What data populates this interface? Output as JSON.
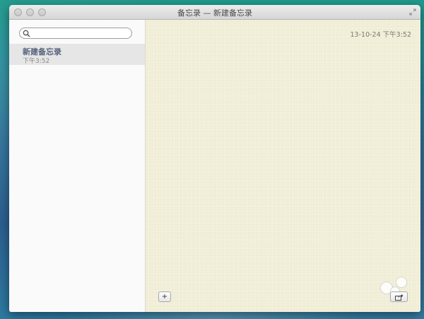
{
  "window": {
    "title": "备忘录 — 新建备忘录"
  },
  "sidebar": {
    "search": {
      "value": "",
      "placeholder": ""
    },
    "notes": [
      {
        "title": "新建备忘录",
        "time": "下午3:52"
      }
    ]
  },
  "editor": {
    "date": "13-10-24 下午3:52",
    "add_label": "+"
  },
  "icons": {
    "search": "search-icon",
    "share": "share-icon",
    "fullscreen": "fullscreen-icon"
  },
  "colors": {
    "paper": "#f2efd9",
    "selected_note": "#e6e6e6",
    "note_title": "#56637a"
  }
}
